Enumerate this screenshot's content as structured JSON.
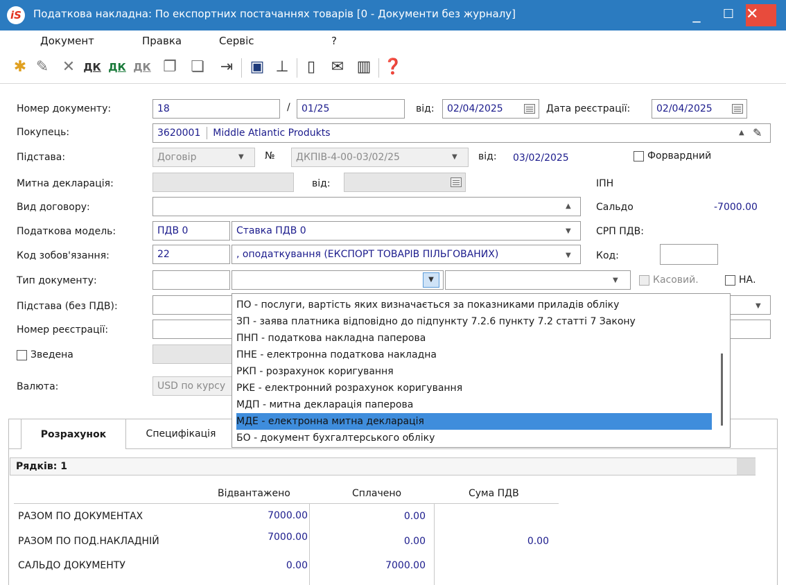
{
  "window": {
    "logo": "iS",
    "title": "Податкова накладна: По експортних  постачаннях товарів [0 - Документи без журналу]",
    "controls": {
      "minimize": "_",
      "maximize": "☐",
      "close": "✕"
    }
  },
  "menu": [
    "Документ",
    "Правка",
    "Сервіс",
    "?"
  ],
  "toolbar": {
    "icons": [
      "new-doc-icon",
      "edit-doc-icon",
      "delete-doc-icon",
      "dk-blue-icon",
      "dk-green-icon",
      "dk-gray-icon",
      "copy-doc-icon",
      "paste-doc-icon",
      "exit-icon",
      "save-icon",
      "hierarchy-icon",
      "form-icon",
      "mail-icon",
      "library-icon",
      "help-icon"
    ],
    "dk_label": "ДК"
  },
  "form": {
    "doc_number_label": "Номер документу:",
    "doc_number": "18",
    "slash": "/",
    "doc_suffix": "01/25",
    "from_label": "від:",
    "doc_date": "02/04/2025",
    "reg_date_label": "Дата реєстрації:",
    "reg_date": "02/04/2025",
    "buyer_label": "Покупець:",
    "buyer_code": "3620001",
    "buyer_name": "Middle Atlantic Produkts",
    "basis_label": "Підстава:",
    "basis_value": "Договір",
    "no_label": "№",
    "basis_number": "ДКПІВ-4-00-03/02/25",
    "basis_from_label": "від:",
    "basis_date": "03/02/2025",
    "forward_label": "Форвардний",
    "customs_label": "Митна декларація:",
    "customs_from_label": "від:",
    "ipn_label": "ІПН",
    "contract_type_label": "Вид договору:",
    "saldo_label": "Сальдо",
    "saldo_value": "-7000.00",
    "tax_model_label": "Податкова модель:",
    "tax_model_code": "ПДВ  0",
    "tax_model_name": "Ставка ПДВ 0",
    "srp_label": "СРП ПДВ:",
    "obligation_label": "Код зобов'язання:",
    "obligation_code": "22",
    "obligation_name": ", оподаткування (ЕКСПОРТ ТОВАРІВ ПІЛЬГОВАНИХ)",
    "code_label": "Код:",
    "doc_type_label": "Тип документу:",
    "cash_label": "Касовий.",
    "na_label": "НА.",
    "basis_no_vat_label": "Підстава (без ПДВ):",
    "reg_number_label": "Номер реєстрації:",
    "consolidated_label": "Зведена",
    "currency_label": "Валюта:",
    "currency_value": "USD по курсу"
  },
  "dropdown": {
    "items": [
      "ПО - послуги, вартість яких визначається за показниками приладів обліку",
      "ЗП - заява платника відповідно до підпункту 7.2.6 пункту 7.2 статті 7 Закону",
      "ПНП - податкова накладна паперова",
      "ПНЕ - електронна податкова накладна",
      "РКП - розрахунок  коригування",
      "РКЕ - електронний розрахунок коригування",
      "МДП - митна  декларація паперова",
      "МДЕ - електронна митна декларація",
      "БО - документ бухгалтерського обліку"
    ],
    "selected_index": 7
  },
  "tabs": [
    "Розрахунок",
    "Специфікація"
  ],
  "summary": {
    "rows_label": "Рядків: 1",
    "columns": [
      "Відвантажено",
      "Сплачено",
      "Сума ПДВ"
    ],
    "rows": [
      {
        "label": "РАЗОМ ПО ДОКУМЕНТАХ",
        "shipped": "7000.00",
        "paid": "0.00",
        "vat": ""
      },
      {
        "label": "РАЗОМ ПО ПОД.НАКЛАДНІЙ",
        "shipped": "7000.00",
        "paid": "0.00",
        "vat": "0.00"
      },
      {
        "label": "САЛЬДО ДОКУМЕНТУ",
        "shipped": "0.00",
        "paid": "7000.00",
        "vat": ""
      }
    ]
  }
}
